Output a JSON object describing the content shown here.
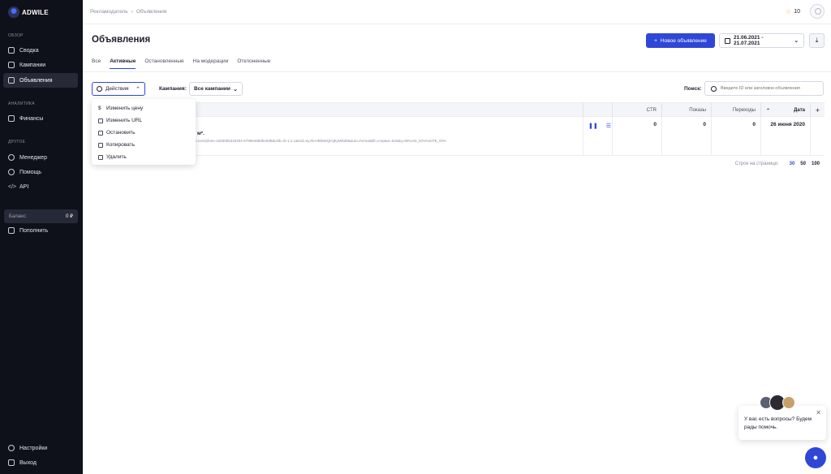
{
  "brand": {
    "name": "ADWILE"
  },
  "sidebar": {
    "sections": [
      {
        "title": "ОБЗОР"
      },
      {
        "title": "АНАЛИТИКА"
      },
      {
        "title": "ДРУГОЕ"
      }
    ],
    "items": [
      {
        "label": "Сводка",
        "icon": "grid-icon"
      },
      {
        "label": "Кампании",
        "icon": "board-icon"
      },
      {
        "label": "Объявления",
        "icon": "ad-icon",
        "active": true
      },
      {
        "label": "Финансы",
        "icon": "wallet-icon"
      },
      {
        "label": "Менеджер",
        "icon": "chat-icon"
      },
      {
        "label": "Помощь",
        "icon": "help-icon"
      },
      {
        "label": "API",
        "icon": "code-icon"
      }
    ],
    "balance": {
      "label": "Баланс:",
      "amount": "0 ₽"
    },
    "topup_label": "Пополнить",
    "settings_label": "Настройки",
    "logout_label": "Выход"
  },
  "topbar": {
    "breadcrumb": [
      "Рекламодатель",
      "Объявления"
    ],
    "stars": "10"
  },
  "header": {
    "title": "Объявления",
    "new_ad_label": "Новое объявление",
    "date_range": "21.06.2021 - 21.07.2021"
  },
  "tabs": [
    {
      "label": "Все"
    },
    {
      "label": "Активные",
      "active": true
    },
    {
      "label": "Остановленные"
    },
    {
      "label": "На модерации"
    },
    {
      "label": "Отклоненные"
    }
  ],
  "filters": {
    "actions_label": "Действия",
    "campaign_label": "Кампания:",
    "campaign_value": "Все кампании",
    "search_label": "Поиск:",
    "search_placeholder": "Введите ID или заголовок объявления"
  },
  "actions_menu": [
    {
      "label": "Изменить цену",
      "icon": "dollar-icon"
    },
    {
      "label": "Изменить URL",
      "icon": "external-link-icon"
    },
    {
      "label": "Остановить",
      "icon": "pause-icon"
    },
    {
      "label": "Копировать",
      "icon": "copy-icon"
    },
    {
      "label": "Удалить",
      "icon": "trash-icon"
    }
  ],
  "table": {
    "columns": {
      "ctr": "CTR",
      "shows": "Показы",
      "clicks": "Переходы",
      "date": "Дата"
    },
    "row": {
      "title_fragment": "м².",
      "url_fragment": "h.com/photo-1593055326304-67965488d5e0d8&ixlib=rb-1.2.1&ixid=eyJhcHBfaWQiOjEyMDd9&auto=format&fit=crop&w=634&q=80%AD_ID%%SITE_ID%",
      "ctr": "0",
      "shows": "0",
      "clicks": "0",
      "date": "26 июня 2020"
    }
  },
  "pagination": {
    "label": "Строк на странице:",
    "options": [
      "30",
      "50",
      "100"
    ],
    "selected": "30"
  },
  "chat": {
    "message": "У вас есть вопросы? Будем рады помочь."
  }
}
